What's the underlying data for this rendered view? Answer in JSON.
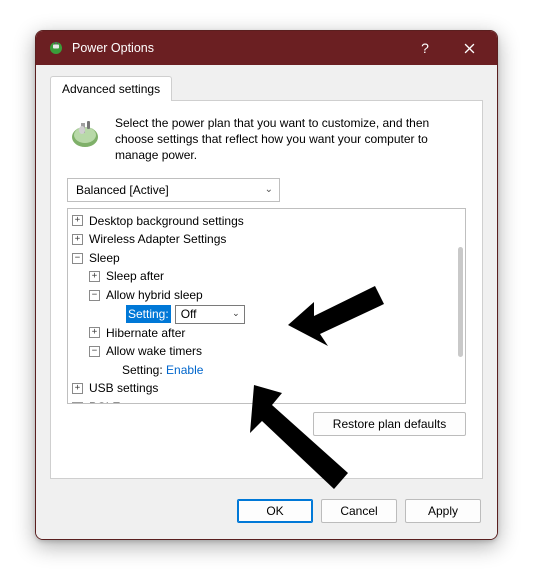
{
  "window": {
    "title": "Power Options"
  },
  "tab": {
    "label": "Advanced settings"
  },
  "intro": {
    "text": "Select the power plan that you want to customize, and then choose settings that reflect how you want your computer to manage power."
  },
  "plan": {
    "selected": "Balanced [Active]"
  },
  "tree": {
    "desktop_bg": "Desktop background settings",
    "wireless": "Wireless Adapter Settings",
    "sleep": "Sleep",
    "sleep_after": "Sleep after",
    "hybrid": "Allow hybrid sleep",
    "hybrid_setting_label": "Setting:",
    "hybrid_setting_value": "Off",
    "hibernate": "Hibernate after",
    "wake_timers": "Allow wake timers",
    "wake_setting_label": "Setting:",
    "wake_setting_value": "Enable",
    "usb": "USB settings",
    "pci": "PCI Express"
  },
  "buttons": {
    "restore": "Restore plan defaults",
    "ok": "OK",
    "cancel": "Cancel",
    "apply": "Apply"
  }
}
